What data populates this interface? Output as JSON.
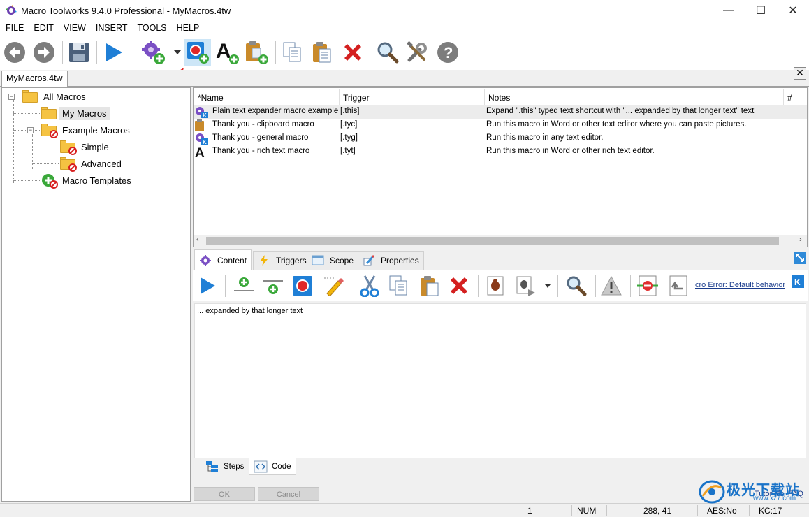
{
  "window": {
    "title": "Macro Toolworks 9.4.0 Professional - MyMacros.4tw",
    "minimize": "—",
    "maximize": "☐",
    "close": "✕"
  },
  "menu": [
    "FILE",
    "EDIT",
    "VIEW",
    "INSERT",
    "TOOLS",
    "HELP"
  ],
  "toolbar": {
    "icons": [
      "back-icon",
      "forward-icon",
      "save-icon",
      "play-icon",
      "new-macro-icon",
      "dropdown-arrow-icon",
      "record-macro-icon",
      "text-macro-icon",
      "clipboard-macro-icon",
      "copy-icon",
      "paste-icon",
      "delete-icon",
      "search-icon",
      "tools-icon",
      "help-icon"
    ],
    "highlighted": "record-macro-icon"
  },
  "document_tab": {
    "label": "MyMacros.4tw",
    "close": "✕"
  },
  "tree": {
    "root": "All Macros",
    "items": [
      "My Macros",
      "Example Macros",
      "Simple",
      "Advanced",
      "Macro Templates"
    ]
  },
  "macro_list": {
    "columns": [
      "*Name",
      "Trigger",
      "Notes",
      "#"
    ],
    "rows": [
      {
        "name": "Plain text expander macro example",
        "trigger": "[.this]",
        "notes": "Expand \".this\" typed text shortcut with \"... expanded by that longer text\" text",
        "icon": "gear-k-icon"
      },
      {
        "name": "Thank you - clipboard macro",
        "trigger": "[.tyc]",
        "notes": "Run this macro in Word or other text editor where you can paste pictures.",
        "icon": "clipboard-icon"
      },
      {
        "name": "Thank you - general macro",
        "trigger": "[.tyg]",
        "notes": "Run this macro in any text editor.",
        "icon": "gear-k-icon"
      },
      {
        "name": "Thank you - rich text macro",
        "trigger": "[.tyt]",
        "notes": "Run this macro in Word or other rich text editor.",
        "icon": "text-a-icon"
      }
    ]
  },
  "panel": {
    "tabs": [
      "Content",
      "Triggers",
      "Scope",
      "Properties"
    ],
    "active_tab": "Content",
    "macro_error_link": "cro Error: Default behavior",
    "editor_text": "... expanded by that longer text",
    "bottom_tabs": [
      "Steps",
      "Code"
    ],
    "active_bottom_tab": "Code",
    "ok": "OK",
    "cancel": "Cancel",
    "tutorials": "Tutorials, FAQ"
  },
  "statusbar": {
    "count": "1",
    "num": "NUM",
    "position": "288,  41",
    "aes": "AES:No",
    "kc": "KC:17"
  },
  "watermark": {
    "text": "极光下载站",
    "url": "www.xz7.com"
  }
}
